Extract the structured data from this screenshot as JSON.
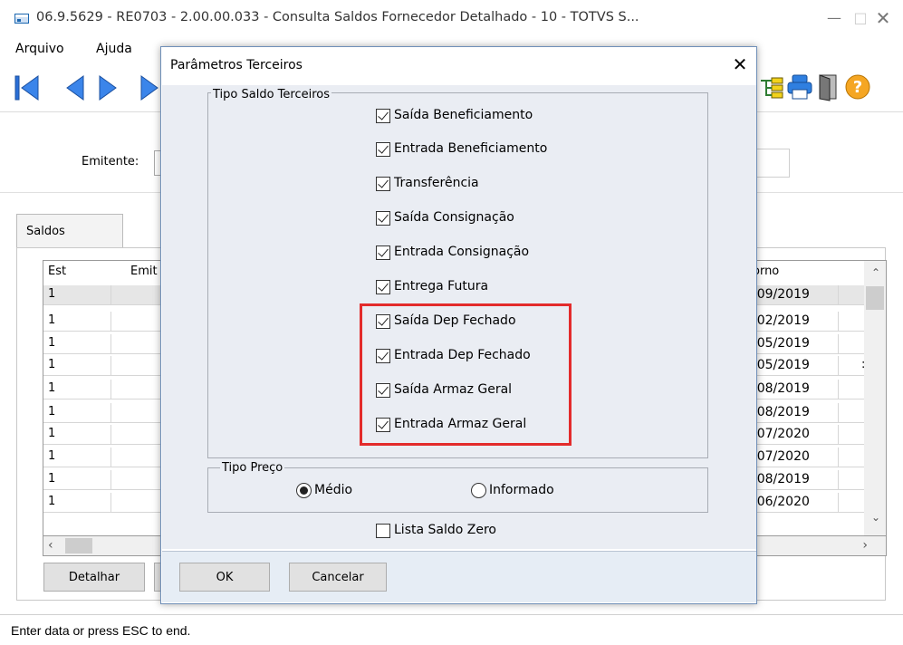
{
  "window": {
    "title": "06.9.5629 - RE0703 - 2.00.00.033 - Consulta Saldos Fornecedor Detalhado - 10 - TOTVS S...",
    "controls": {
      "minimize": "—",
      "maximize": "□",
      "close": "✕"
    }
  },
  "menu": {
    "arquivo": "Arquivo",
    "ajuda": "Ajuda"
  },
  "toolbar": {
    "nav_icons": [
      "first-record-icon",
      "previous-record-icon",
      "next-record-icon",
      "last-record-icon"
    ],
    "right_icons": [
      "structure-icon",
      "printer-icon",
      "exit-door-icon",
      "help-icon"
    ]
  },
  "form": {
    "emitente_label": "Emitente:"
  },
  "tabs": {
    "saldos": "Saldos"
  },
  "grid": {
    "columns": {
      "est": "Est",
      "emit": "Emit",
      "retorno": "orno"
    },
    "rows": [
      {
        "est": "1",
        "date": "/09/2019",
        "extra": ""
      },
      {
        "est": "1",
        "date": "/02/2019",
        "extra": ""
      },
      {
        "est": "1",
        "date": "/05/2019",
        "extra": ""
      },
      {
        "est": "1",
        "date": "/05/2019",
        "extra": ":"
      },
      {
        "est": "1",
        "date": "/08/2019",
        "extra": ""
      },
      {
        "est": "1",
        "date": "/08/2019",
        "extra": ""
      },
      {
        "est": "1",
        "date": "/07/2020",
        "extra": ""
      },
      {
        "est": "1",
        "date": "/07/2020",
        "extra": ""
      },
      {
        "est": "1",
        "date": "/08/2019",
        "extra": ""
      },
      {
        "est": "1",
        "date": "/06/2020",
        "extra": ""
      }
    ]
  },
  "buttons": {
    "detalhar": "Detalhar"
  },
  "statusbar": {
    "text": "Enter data or press ESC to end."
  },
  "dialog": {
    "title": "Parâmetros Terceiros",
    "close": "✕",
    "tipo_saldo": {
      "legend": "Tipo Saldo Terceiros",
      "options": [
        {
          "label": "Saída Beneficiamento",
          "checked": true
        },
        {
          "label": "Entrada Beneficiamento",
          "checked": true
        },
        {
          "label": "Transferência",
          "checked": true
        },
        {
          "label": "Saída Consignação",
          "checked": true
        },
        {
          "label": "Entrada Consignação",
          "checked": true
        },
        {
          "label": "Entrega Futura",
          "checked": true
        },
        {
          "label": "Saída Dep Fechado",
          "checked": true
        },
        {
          "label": "Entrada Dep Fechado",
          "checked": true
        },
        {
          "label": "Saída Armaz Geral",
          "checked": true
        },
        {
          "label": "Entrada Armaz Geral",
          "checked": true
        }
      ]
    },
    "tipo_preco": {
      "legend": "Tipo Preço",
      "options": [
        {
          "label": "Médio",
          "selected": true
        },
        {
          "label": "Informado",
          "selected": false
        }
      ]
    },
    "lista_saldo_zero": {
      "label": "Lista Saldo Zero",
      "checked": false
    },
    "ok": "OK",
    "cancelar": "Cancelar",
    "highlight_color": "#e32b2b"
  }
}
